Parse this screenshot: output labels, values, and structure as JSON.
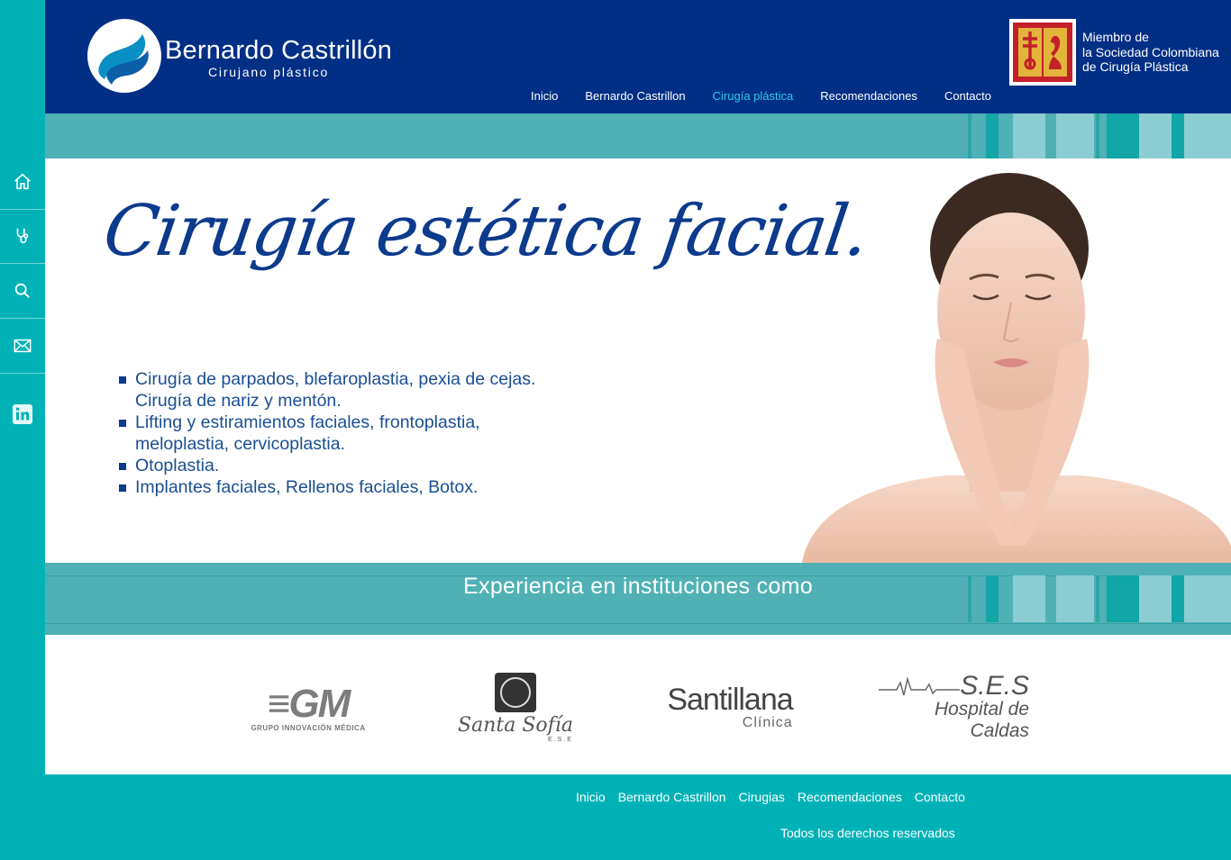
{
  "rail": {
    "icons": [
      "home-icon",
      "stethoscope-icon",
      "search-icon",
      "mail-icon",
      "linkedin-icon"
    ]
  },
  "header": {
    "brand_name": "Bernardo Castrillón",
    "brand_subtitle": "Cirujano plástico",
    "nav": [
      "Inicio",
      "Bernardo Castrillon",
      "Cirugía plástica",
      "Recomendaciones",
      "Contacto"
    ],
    "active_nav": "Cirugía plástica",
    "society_line1": "Miembro de",
    "society_line2": "la Sociedad Colombiana",
    "society_line3": "de Cirugía Plástica"
  },
  "hero": {
    "title": "Cirugía estética facial.",
    "items": [
      "Cirugía de parpados, blefaroplastia, pexia de cejas. Cirugía de nariz y mentón.",
      "Lifting y estiramientos faciales, frontoplastia, meloplastia, cervicoplastia.",
      "Otoplastia.",
      "Implantes faciales, Rellenos faciales, Botox."
    ]
  },
  "experience": {
    "title": "Experiencia en instituciones como",
    "institutions": [
      {
        "mark": "GM",
        "caption": "GRUPO INNOVACIÓN MÉDICA"
      },
      {
        "mark": "Santa Sofía",
        "caption": "E.S.E"
      },
      {
        "mark": "Santillana",
        "caption": "Clínica"
      },
      {
        "mark": "S.E.S",
        "caption": "Hospital de Caldas"
      }
    ]
  },
  "footer": {
    "nav": [
      "Inicio",
      "Bernardo Castrillon",
      "Cirugias",
      "Recomendaciones",
      "Contacto"
    ],
    "copyright": "Todos los derechos reservados"
  },
  "colors": {
    "header_blue": "#022f86",
    "teal": "#00b2b6",
    "band_teal": "#4fb1b5",
    "active_link": "#2fc7e7",
    "text_blue": "#1a4e94"
  }
}
